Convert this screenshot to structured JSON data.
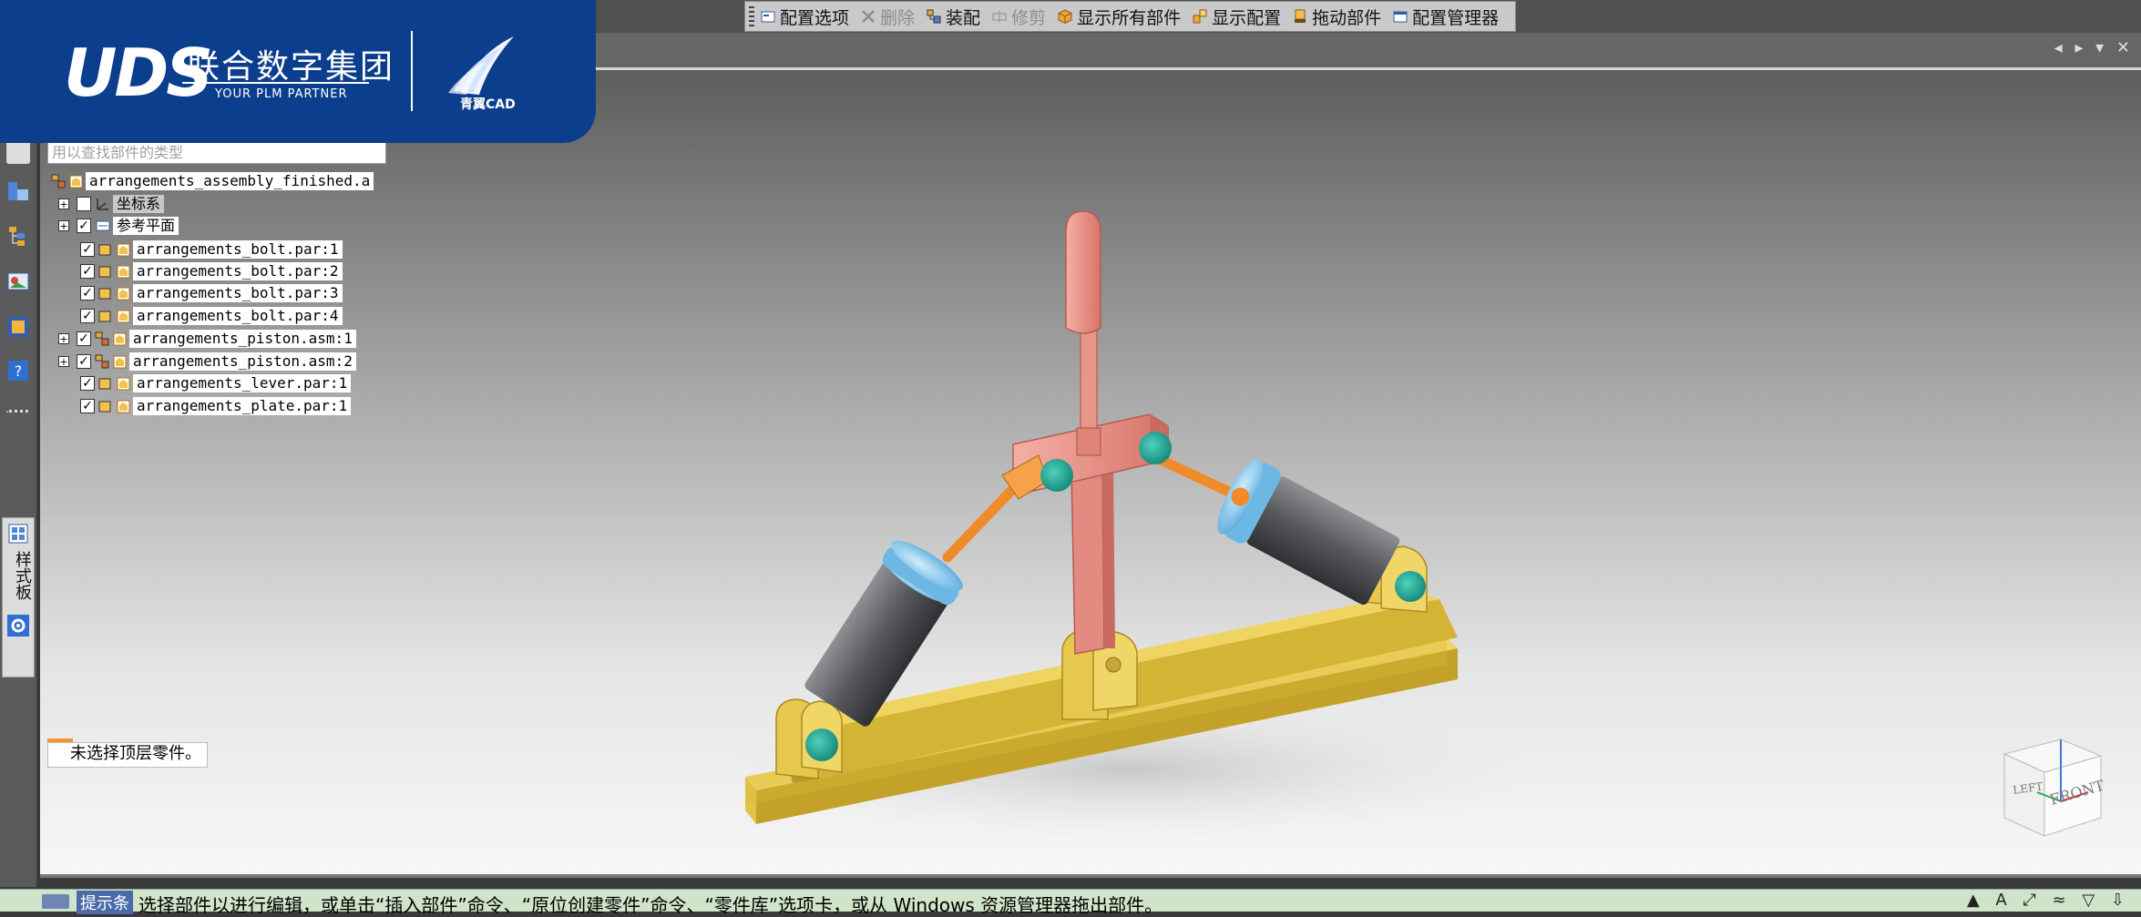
{
  "toolbar": {
    "items": [
      {
        "label": "配置选项",
        "icon": "config-options-icon",
        "enabled": true
      },
      {
        "label": "删除",
        "icon": "delete-icon",
        "enabled": false
      },
      {
        "label": "装配",
        "icon": "assemble-icon",
        "enabled": true
      },
      {
        "label": "修剪",
        "icon": "trim-icon",
        "enabled": false
      },
      {
        "label": "显示所有部件",
        "icon": "show-all-parts-icon",
        "enabled": true
      },
      {
        "label": "显示配置",
        "icon": "show-config-icon",
        "enabled": true
      },
      {
        "label": "拖动部件",
        "icon": "drag-part-icon",
        "enabled": true
      },
      {
        "label": "配置管理器",
        "icon": "config-manager-icon",
        "enabled": true
      }
    ]
  },
  "logo": {
    "mark": "UDS",
    "company_cn": "联合数字集团",
    "company_en": "YOUR PLM PARTNER",
    "product": "青翼CAD"
  },
  "tree": {
    "search_placeholder": "用以查找部件的类型",
    "root": "arrangements_assembly_finished.a",
    "nodes": [
      {
        "label": "坐标系",
        "expandable": true,
        "checked": false
      },
      {
        "label": "参考平面",
        "expandable": true,
        "checked": true
      },
      {
        "label": "arrangements_bolt.par:1",
        "expandable": false,
        "checked": true
      },
      {
        "label": "arrangements_bolt.par:2",
        "expandable": false,
        "checked": true
      },
      {
        "label": "arrangements_bolt.par:3",
        "expandable": false,
        "checked": true
      },
      {
        "label": "arrangements_bolt.par:4",
        "expandable": false,
        "checked": true
      },
      {
        "label": "arrangements_piston.asm:1",
        "expandable": true,
        "checked": true
      },
      {
        "label": "arrangements_piston.asm:2",
        "expandable": true,
        "checked": true
      },
      {
        "label": "arrangements_lever.par:1",
        "expandable": false,
        "checked": true
      },
      {
        "label": "arrangements_plate.par:1",
        "expandable": false,
        "checked": true
      }
    ]
  },
  "left_panel": {
    "palette_tab": "样式板"
  },
  "selection_status": "未选择顶层零件。",
  "status_bar": {
    "hint_label": "提示条",
    "hint_text": "选择部件以进行编辑，或单击“插入部件”命令、“原位创建零件”命令、“零件库”选项卡，或从 Windows 资源管理器拖出部件。"
  },
  "view_cube": {
    "left": "LEFT",
    "front": "FRONT"
  },
  "colors": {
    "brand_blue": "#0b3e8c",
    "plate": "#d9b934",
    "lever": "#e6938a",
    "cylinder": "#5d5f63",
    "cap": "#7ec3ea",
    "pin": "#1aa193",
    "rod": "#f08a2a"
  }
}
